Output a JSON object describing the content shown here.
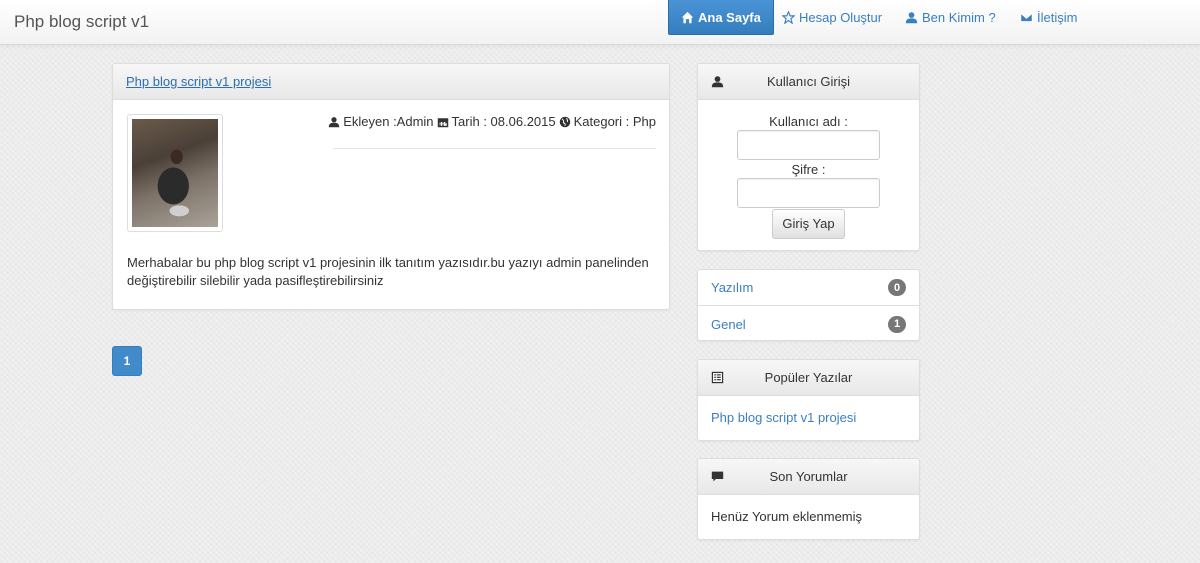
{
  "navbar": {
    "brand": "Php blog script v1",
    "items": [
      {
        "label": "Ana Sayfa",
        "icon": "home-icon",
        "active": true
      },
      {
        "label": "Hesap Oluştur",
        "icon": "star-icon"
      },
      {
        "label": "Ben Kimim ?",
        "icon": "user-icon"
      },
      {
        "label": "İletişim",
        "icon": "envelope-icon"
      }
    ]
  },
  "post": {
    "title": "Php blog script v1 projesi",
    "meta": {
      "author": "Ekleyen :Admin",
      "date": "Tarih : 08.06.2015",
      "category": "Kategori : Php"
    },
    "body": "Merhabalar bu php blog script v1 projesinin ilk tanıtım yazısıdır.bu yazıyı admin panelinden değiştirebilir silebilir yada pasifleştirebilirsiniz"
  },
  "pagination": {
    "current": "1"
  },
  "login": {
    "title": "Kullanıcı Girişi",
    "username_label": "Kullanıcı adı :",
    "username_value": "",
    "password_label": "Şifre :",
    "password_value": "",
    "submit_label": "Giriş Yap"
  },
  "categories": [
    {
      "name": "Yazılım",
      "count": "0"
    },
    {
      "name": "Genel",
      "count": "1"
    }
  ],
  "popular": {
    "title": "Popüler Yazılar",
    "items": [
      "Php blog script v1 projesi"
    ]
  },
  "comments": {
    "title": "Son Yorumlar",
    "empty_text": "Henüz Yorum eklenmemiş"
  },
  "colors": {
    "link": "#3a7fc1",
    "primary": "#428bca",
    "badge": "#777777"
  }
}
